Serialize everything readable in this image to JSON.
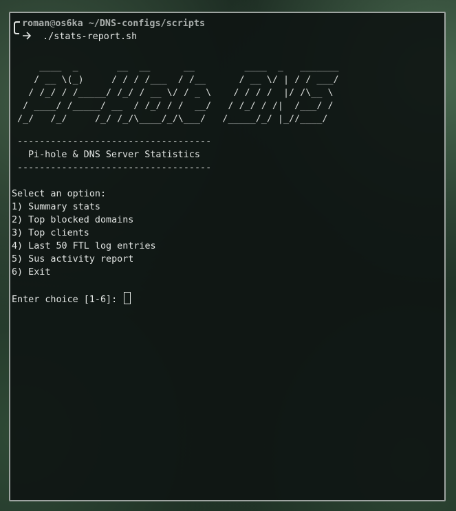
{
  "prompt": {
    "user": "roman",
    "at": "@",
    "host": "os6ka",
    "path": " ~/DNS-configs/scripts",
    "command": "./stats-report.sh"
  },
  "banner": [
    "    ____  _       __  __      __         ____  _   _______",
    "   / __ \\(_)     / / / /___  / /__      / __ \\/ | / / ___/",
    "  / /_/ / /_____/ /_/ / __ \\/ / _ \\    / / / /  |/ /\\__ \\ ",
    " / ____/ /_____/ __  / /_/ / /  __/   / /_/ / /|  /___/ / ",
    "/_/   /_/     /_/ /_/\\____/_/\\___/   /_____/_/ |_//____/  "
  ],
  "separator_top": "-----------------------------------",
  "subtitle": "Pi-hole & DNS Server Statistics",
  "separator_bottom": "-----------------------------------",
  "menu": {
    "heading": "Select an option:",
    "options": [
      "1) Summary stats",
      "2) Top blocked domains",
      "3) Top clients",
      "4) Last 50 FTL log entries",
      "5) Sus activity report",
      "6) Exit"
    ],
    "input_prompt": "Enter choice [1-6]: "
  },
  "icons": {
    "prompt_arrow": "corner-arrow-icon",
    "cursor": "block-cursor-icon"
  },
  "colors": {
    "text": "#e3e6e4",
    "prompt_dim": "#a9aeac",
    "border": "#9ea4a1"
  }
}
